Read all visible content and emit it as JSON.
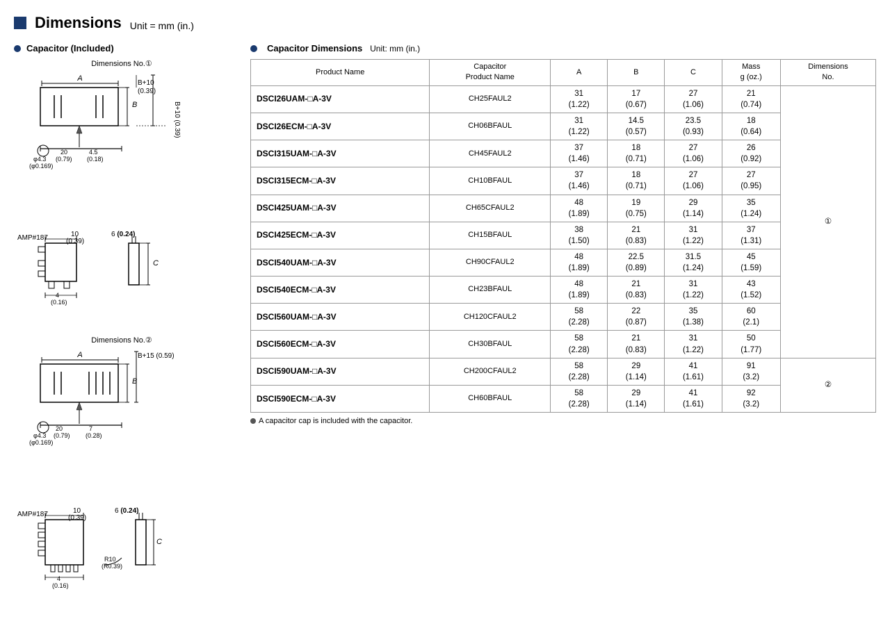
{
  "header": {
    "square_color": "#1a3a6e",
    "title": "Dimensions",
    "unit": "Unit = mm (in.)"
  },
  "left": {
    "section_title": "Capacitor (Included)",
    "diagram1_label": "Dimensions No.①",
    "diagram2_label": "Dimensions No.②"
  },
  "right": {
    "table_title": "Capacitor Dimensions",
    "table_unit": "Unit: mm (in.)",
    "columns": [
      "Product Name",
      "Capacitor\nProduct Name",
      "A",
      "B",
      "C",
      "Mass\ng (oz.)",
      "Dimensions\nNo."
    ],
    "rows": [
      {
        "product": "DSCI26UAM-□A-3V",
        "cap": "CH25FAUL2",
        "A": "31\n(1.22)",
        "B": "17\n(0.67)",
        "C": "27\n(1.06)",
        "mass": "21\n(0.74)",
        "dim_no": "①",
        "dim_no_rowspan": 10
      },
      {
        "product": "DSCI26ECM-□A-3V",
        "cap": "CH06BFAUL",
        "A": "31\n(1.22)",
        "B": "14.5\n(0.57)",
        "C": "23.5\n(0.93)",
        "mass": "18\n(0.64)"
      },
      {
        "product": "DSCI315UAM-□A-3V",
        "cap": "CH45FAUL2",
        "A": "37\n(1.46)",
        "B": "18\n(0.71)",
        "C": "27\n(1.06)",
        "mass": "26\n(0.92)"
      },
      {
        "product": "DSCI315ECM-□A-3V",
        "cap": "CH10BFAUL",
        "A": "37\n(1.46)",
        "B": "18\n(0.71)",
        "C": "27\n(1.06)",
        "mass": "27\n(0.95)"
      },
      {
        "product": "DSCI425UAM-□A-3V",
        "cap": "CH65CFAUL2",
        "A": "48\n(1.89)",
        "B": "19\n(0.75)",
        "C": "29\n(1.14)",
        "mass": "35\n(1.24)"
      },
      {
        "product": "DSCI425ECM-□A-3V",
        "cap": "CH15BFAUL",
        "A": "38\n(1.50)",
        "B": "21\n(0.83)",
        "C": "31\n(1.22)",
        "mass": "37\n(1.31)"
      },
      {
        "product": "DSCI540UAM-□A-3V",
        "cap": "CH90CFAUL2",
        "A": "48\n(1.89)",
        "B": "22.5\n(0.89)",
        "C": "31.5\n(1.24)",
        "mass": "45\n(1.59)"
      },
      {
        "product": "DSCI540ECM-□A-3V",
        "cap": "CH23BFAUL",
        "A": "48\n(1.89)",
        "B": "21\n(0.83)",
        "C": "31\n(1.22)",
        "mass": "43\n(1.52)"
      },
      {
        "product": "DSCI560UAM-□A-3V",
        "cap": "CH120CFAUL2",
        "A": "58\n(2.28)",
        "B": "22\n(0.87)",
        "C": "35\n(1.38)",
        "mass": "60\n(2.1)"
      },
      {
        "product": "DSCI560ECM-□A-3V",
        "cap": "CH30BFAUL",
        "A": "58\n(2.28)",
        "B": "21\n(0.83)",
        "C": "31\n(1.22)",
        "mass": "50\n(1.77)"
      },
      {
        "product": "DSCI590UAM-□A-3V",
        "cap": "CH200CFAUL2",
        "A": "58\n(2.28)",
        "B": "29\n(1.14)",
        "C": "41\n(1.61)",
        "mass": "91\n(3.2)",
        "dim_no": "②",
        "dim_no_rowspan": 2
      },
      {
        "product": "DSCI590ECM-□A-3V",
        "cap": "CH60BFAUL",
        "A": "58\n(2.28)",
        "B": "29\n(1.14)",
        "C": "41\n(1.61)",
        "mass": "92\n(3.2)"
      }
    ],
    "footnote": "A capacitor cap is included with the capacitor."
  }
}
